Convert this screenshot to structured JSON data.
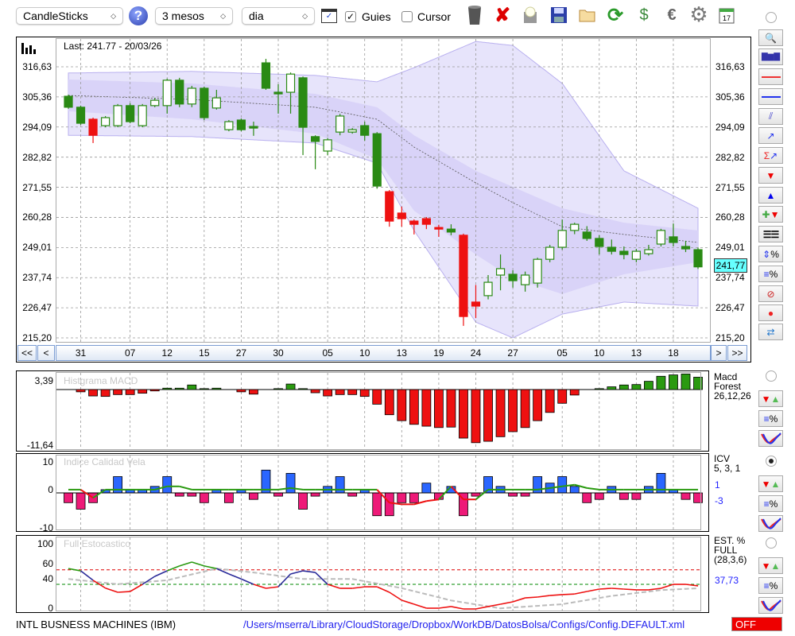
{
  "toolbar": {
    "chart_type": "CandleSticks",
    "period": "3 mesos",
    "interval": "dia",
    "guides_label": "Guies",
    "guides_checked": true,
    "cursor_label": "Cursor",
    "cursor_checked": false
  },
  "main": {
    "last_label": "Last: 241.77 - 20/03/26",
    "last_price": "241,77",
    "price_labels": [
      "316,63",
      "305,36",
      "294,09",
      "282,82",
      "271,55",
      "260,28",
      "249,01",
      "237,74",
      "226,47",
      "215,20"
    ],
    "price_ticks": [
      316.63,
      305.36,
      294.09,
      282.82,
      271.55,
      260.28,
      249.01,
      237.74,
      226.47,
      215.2
    ],
    "nav": {
      "first": "<<",
      "prev": "<",
      "next": ">",
      "last": ">>"
    },
    "date_labels": [
      "31",
      "07",
      "12",
      "15",
      "27",
      "30",
      "05",
      "10",
      "13",
      "19",
      "24",
      "27",
      "05",
      "10",
      "13",
      "18"
    ],
    "date_index": [
      1,
      5,
      8,
      11,
      14,
      17,
      21,
      24,
      27,
      30,
      33,
      36,
      40,
      43,
      46,
      49
    ]
  },
  "chart_data": [
    {
      "type": "candlestick",
      "title": "IBM daily",
      "ylim": [
        215.2,
        316.63
      ],
      "colors": {
        "up": "#2a8a14",
        "red": "#ee1111",
        "band_outer": "#e7e4fb",
        "band_inner": "#d9d3f8"
      },
      "candles": [
        [
          305.6,
          306.2,
          300.9,
          301.5,
          "g"
        ],
        [
          301.5,
          302.1,
          294.9,
          295.5,
          "g"
        ],
        [
          297.0,
          297.6,
          288.1,
          291.0,
          "r"
        ],
        [
          294.6,
          298.2,
          294.0,
          297.6,
          "g"
        ],
        [
          294.6,
          302.7,
          294.0,
          302.1,
          "g"
        ],
        [
          302.1,
          303.0,
          295.5,
          296.1,
          "g"
        ],
        [
          294.6,
          302.7,
          294.0,
          302.1,
          "g"
        ],
        [
          302.1,
          305.0,
          301.5,
          304.1,
          "g"
        ],
        [
          302.1,
          312.2,
          299.1,
          311.6,
          "g"
        ],
        [
          311.6,
          312.5,
          301.5,
          302.7,
          "g"
        ],
        [
          302.7,
          309.5,
          301.5,
          308.6,
          "g"
        ],
        [
          308.6,
          309.2,
          296.7,
          297.6,
          "g"
        ],
        [
          301.2,
          308.0,
          300.6,
          305.0,
          "g"
        ],
        [
          293.1,
          296.7,
          292.5,
          296.1,
          "g"
        ],
        [
          296.7,
          297.3,
          292.5,
          293.1,
          "g"
        ],
        [
          294.3,
          296.1,
          290.8,
          293.7,
          "g"
        ],
        [
          318.1,
          319.6,
          308.0,
          308.6,
          "g"
        ],
        [
          307.1,
          310.1,
          299.1,
          306.5,
          "g"
        ],
        [
          307.1,
          314.5,
          299.1,
          313.9,
          "g"
        ],
        [
          312.5,
          313.0,
          283.6,
          294.0,
          "g"
        ],
        [
          290.5,
          291.0,
          278.3,
          288.7,
          "g"
        ],
        [
          285.1,
          290.0,
          283.6,
          289.3,
          "g"
        ],
        [
          292.2,
          299.0,
          291.0,
          298.2,
          "g"
        ],
        [
          292.2,
          293.7,
          291.6,
          293.1,
          "g"
        ],
        [
          294.6,
          296.1,
          289.0,
          291.0,
          "g"
        ],
        [
          291.6,
          292.2,
          271.0,
          272.0,
          "g"
        ],
        [
          269.9,
          270.5,
          256.8,
          258.9,
          "r"
        ],
        [
          261.9,
          264.3,
          256.8,
          259.8,
          "r"
        ],
        [
          258.9,
          259.5,
          253.9,
          257.7,
          "r"
        ],
        [
          259.8,
          260.4,
          255.9,
          257.7,
          "r"
        ],
        [
          256.5,
          257.5,
          253.0,
          255.9,
          "r"
        ],
        [
          255.9,
          257.7,
          253.6,
          254.8,
          "g"
        ],
        [
          253.6,
          254.2,
          219.7,
          223.2,
          "r"
        ],
        [
          228.6,
          235.0,
          222.6,
          227.1,
          "r"
        ],
        [
          231.0,
          238.7,
          229.6,
          236.0,
          "g"
        ],
        [
          238.7,
          246.4,
          233.0,
          241.1,
          "g"
        ],
        [
          239.0,
          240.5,
          234.0,
          236.6,
          "g"
        ],
        [
          235.1,
          240.0,
          232.5,
          238.7,
          "g"
        ],
        [
          235.7,
          245.2,
          234.0,
          244.6,
          "g"
        ],
        [
          244.6,
          250.0,
          243.5,
          249.1,
          "g"
        ],
        [
          249.1,
          259.5,
          248.2,
          255.4,
          "g"
        ],
        [
          255.4,
          258.3,
          254.0,
          257.7,
          "g"
        ],
        [
          254.8,
          257.0,
          251.5,
          252.4,
          "g"
        ],
        [
          252.4,
          253.6,
          246.4,
          249.4,
          "g"
        ],
        [
          249.1,
          252.0,
          246.4,
          247.6,
          "g"
        ],
        [
          247.6,
          249.4,
          244.6,
          246.4,
          "g"
        ],
        [
          244.6,
          248.5,
          243.5,
          247.6,
          "g"
        ],
        [
          246.7,
          250.0,
          246.0,
          248.2,
          "g"
        ],
        [
          250.3,
          256.0,
          249.4,
          255.4,
          "g"
        ],
        [
          253.0,
          258.0,
          249.4,
          250.9,
          "g"
        ],
        [
          249.4,
          251.5,
          247.3,
          248.5,
          "g"
        ],
        [
          248.2,
          249.0,
          241.0,
          241.77,
          "g"
        ]
      ],
      "band_anchor_index": [
        0,
        10,
        20,
        25,
        28,
        33,
        36,
        40,
        45,
        51
      ],
      "outer_upper": [
        314.3,
        314.9,
        313.4,
        311.0,
        316.3,
        326.1,
        324.6,
        310.4,
        277.7,
        263.7
      ],
      "outer_lower": [
        291.0,
        290.5,
        288.1,
        280.6,
        255.4,
        221.1,
        215.2,
        224.1,
        228.6,
        227.1
      ],
      "inner_upper": [
        311.9,
        310.4,
        306.5,
        301.5,
        291.0,
        277.7,
        271.7,
        263.7,
        258.3,
        255.4
      ],
      "inner_lower": [
        300.0,
        297.0,
        291.6,
        282.1,
        262.8,
        246.4,
        237.5,
        231.6,
        239.0,
        243.5
      ],
      "middle": [
        305.9,
        304.4,
        301.5,
        297.0,
        286.6,
        273.2,
        265.8,
        256.8,
        253.9,
        250.9
      ]
    },
    {
      "type": "bar",
      "title": "Histgrama MACD",
      "ylim": [
        -11.64,
        3.39
      ],
      "ylabels": [
        "3,39",
        "-11,64"
      ],
      "side": [
        "Macd",
        "Forest",
        "26,12,26"
      ],
      "values": [
        0,
        -0.5,
        -1.4,
        -1.5,
        -1.1,
        -1.1,
        -0.8,
        -0.3,
        0.3,
        0.3,
        1.0,
        0.2,
        0.3,
        0,
        -0.5,
        -1.0,
        0,
        0.2,
        1.2,
        0.2,
        -0.7,
        -1.4,
        -1.1,
        -1.1,
        -1.5,
        -3.2,
        -5.5,
        -6.8,
        -7.6,
        -8.0,
        -8.3,
        -8.2,
        -10.6,
        -11.6,
        -11.3,
        -10.3,
        -9.2,
        -8.3,
        -6.8,
        -5.0,
        -3.0,
        -1.2,
        0,
        0.2,
        0.6,
        1.0,
        1.1,
        1.8,
        2.9,
        3.2,
        3.4,
        2.7
      ]
    },
    {
      "type": "bar",
      "title": "Indice Calidad Vela",
      "ylim": [
        -10,
        10
      ],
      "ylabels": [
        "10",
        "0",
        "-10"
      ],
      "side": [
        "ICV",
        "5, 3, 1"
      ],
      "levels": [
        "1",
        "-3"
      ],
      "values": [
        -3,
        -5,
        -3,
        1,
        5,
        1,
        1,
        2,
        5,
        -1,
        -1,
        -3,
        1,
        -3,
        1,
        -2,
        7,
        -1,
        6,
        -5,
        -1,
        2,
        5,
        -1,
        1,
        -7,
        -7,
        -3,
        -3,
        3,
        -2,
        2,
        -7,
        -1,
        5,
        2,
        -1,
        -1,
        5,
        3,
        5,
        2,
        -3,
        -2,
        2,
        -2,
        -2,
        2,
        6,
        1,
        -2,
        -3
      ],
      "line": [
        1,
        1,
        -1.5,
        1,
        1,
        1,
        1,
        1,
        2,
        2,
        1,
        1,
        1,
        1,
        1,
        1,
        1,
        1,
        1.5,
        1,
        1,
        1,
        1,
        1,
        1,
        1,
        -3,
        -3.5,
        -3.5,
        -2.5,
        -2,
        2,
        -2,
        -2,
        1,
        1,
        1,
        1,
        1,
        1.5,
        2,
        2.5,
        1.5,
        1,
        1,
        1,
        1,
        1,
        1,
        1,
        1,
        1
      ]
    },
    {
      "type": "line",
      "title": "Full Estocastico",
      "ylim": [
        0,
        100
      ],
      "ylabels": [
        "100",
        "60",
        "40",
        "0"
      ],
      "side": [
        "EST. %",
        "FULL",
        "(28,3,6)"
      ],
      "current": "37,73",
      "upper_level": 60,
      "lower_level": 37.73,
      "k": [
        62,
        58.5,
        44,
        32,
        25.6,
        26.8,
        37.8,
        50,
        58.5,
        66,
        72,
        66,
        62,
        53.7,
        46,
        37.8,
        31.7,
        34,
        53.7,
        58.5,
        56,
        37.8,
        31.7,
        31.7,
        34,
        34,
        25.6,
        13.4,
        7.3,
        1.2,
        1.2,
        3.7,
        0,
        0,
        3.7,
        7.3,
        11,
        17,
        18.3,
        20.7,
        22,
        23,
        26.8,
        30.5,
        31.7,
        30.5,
        29.3,
        29.3,
        31.7,
        37.8,
        37.8,
        35.4
      ],
      "d_anchor_index": [
        0,
        4,
        8,
        12,
        15,
        19,
        23,
        27,
        31,
        35,
        40,
        44,
        48,
        51
      ],
      "d_anchor_values": [
        46,
        38,
        44,
        62,
        56,
        46,
        46,
        32,
        13,
        1,
        7.3,
        20,
        29,
        31.7
      ]
    }
  ],
  "footer": {
    "symbol": "INTL BUSNESS MACHINES (IBM)",
    "path": "/Users/mserra/Library/CloudStorage/Dropbox/WorkDB/DatosBolsa/Configs/Config.DEFAULT.xml",
    "status": "OFF"
  },
  "right_tools": [
    "zoom",
    "candles-view",
    "red-line",
    "blue-line",
    "channel",
    "trendline",
    "sum-trendline",
    "sell-arrow",
    "buy-arrow",
    "add-signal",
    "grid-lines",
    "range-percent",
    "level-percent",
    "delete",
    "record",
    "refresh"
  ],
  "sub_tools": [
    "arrows",
    "level-percent",
    "curve"
  ]
}
